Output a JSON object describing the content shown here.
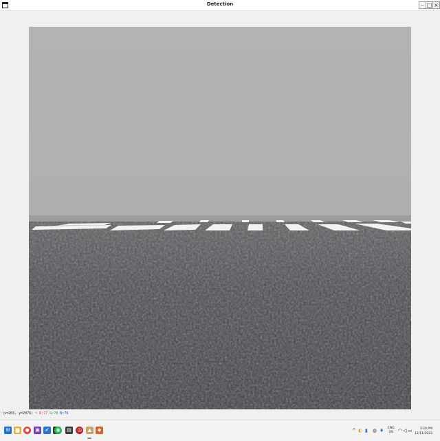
{
  "window": {
    "title": "Detection",
    "icon": "app-window-icon",
    "controls": {
      "minimize": "–",
      "maximize": "□",
      "close": "×"
    }
  },
  "viewport": {
    "description_colors": {
      "sky": "#b2b2b2",
      "horizon": "#9c9c9c",
      "asphalt": "#4a4a4e",
      "marking": "#f4f4f4"
    }
  },
  "status": {
    "coords": "(x=203, y=2076) ~",
    "r": "R:77",
    "g": "G:78",
    "b": "B:76"
  },
  "taskbar": {
    "icons": [
      {
        "name": "start-icon",
        "glyph": "⊞",
        "color": "#1e6fd9"
      },
      {
        "name": "file-explorer-icon",
        "glyph": "▆",
        "color": "#e8b23a"
      },
      {
        "name": "browser-icon",
        "glyph": "●",
        "color": "#e0463a"
      },
      {
        "name": "terminal-icon",
        "glyph": "▣",
        "color": "#6a3fb8"
      },
      {
        "name": "todo-icon",
        "glyph": "✔",
        "color": "#2f6fd8"
      },
      {
        "name": "app-icon",
        "glyph": "◧",
        "color": "#3a3a3a"
      },
      {
        "name": "spotify-icon",
        "glyph": "◉",
        "color": "#1db954"
      },
      {
        "name": "media-icon",
        "glyph": "▤",
        "color": "#3a3a3a"
      },
      {
        "name": "clock-app-icon",
        "glyph": "◷",
        "color": "#c02424"
      },
      {
        "name": "python-window-icon",
        "glyph": "▲",
        "color": "#c6a36a"
      },
      {
        "name": "misc-app-icon",
        "glyph": "◆",
        "color": "#d9622b"
      }
    ],
    "tray": {
      "chevron": "^",
      "language": "ENG",
      "region": "US",
      "time": "3:29 PM",
      "date": "12/11/2023"
    }
  }
}
